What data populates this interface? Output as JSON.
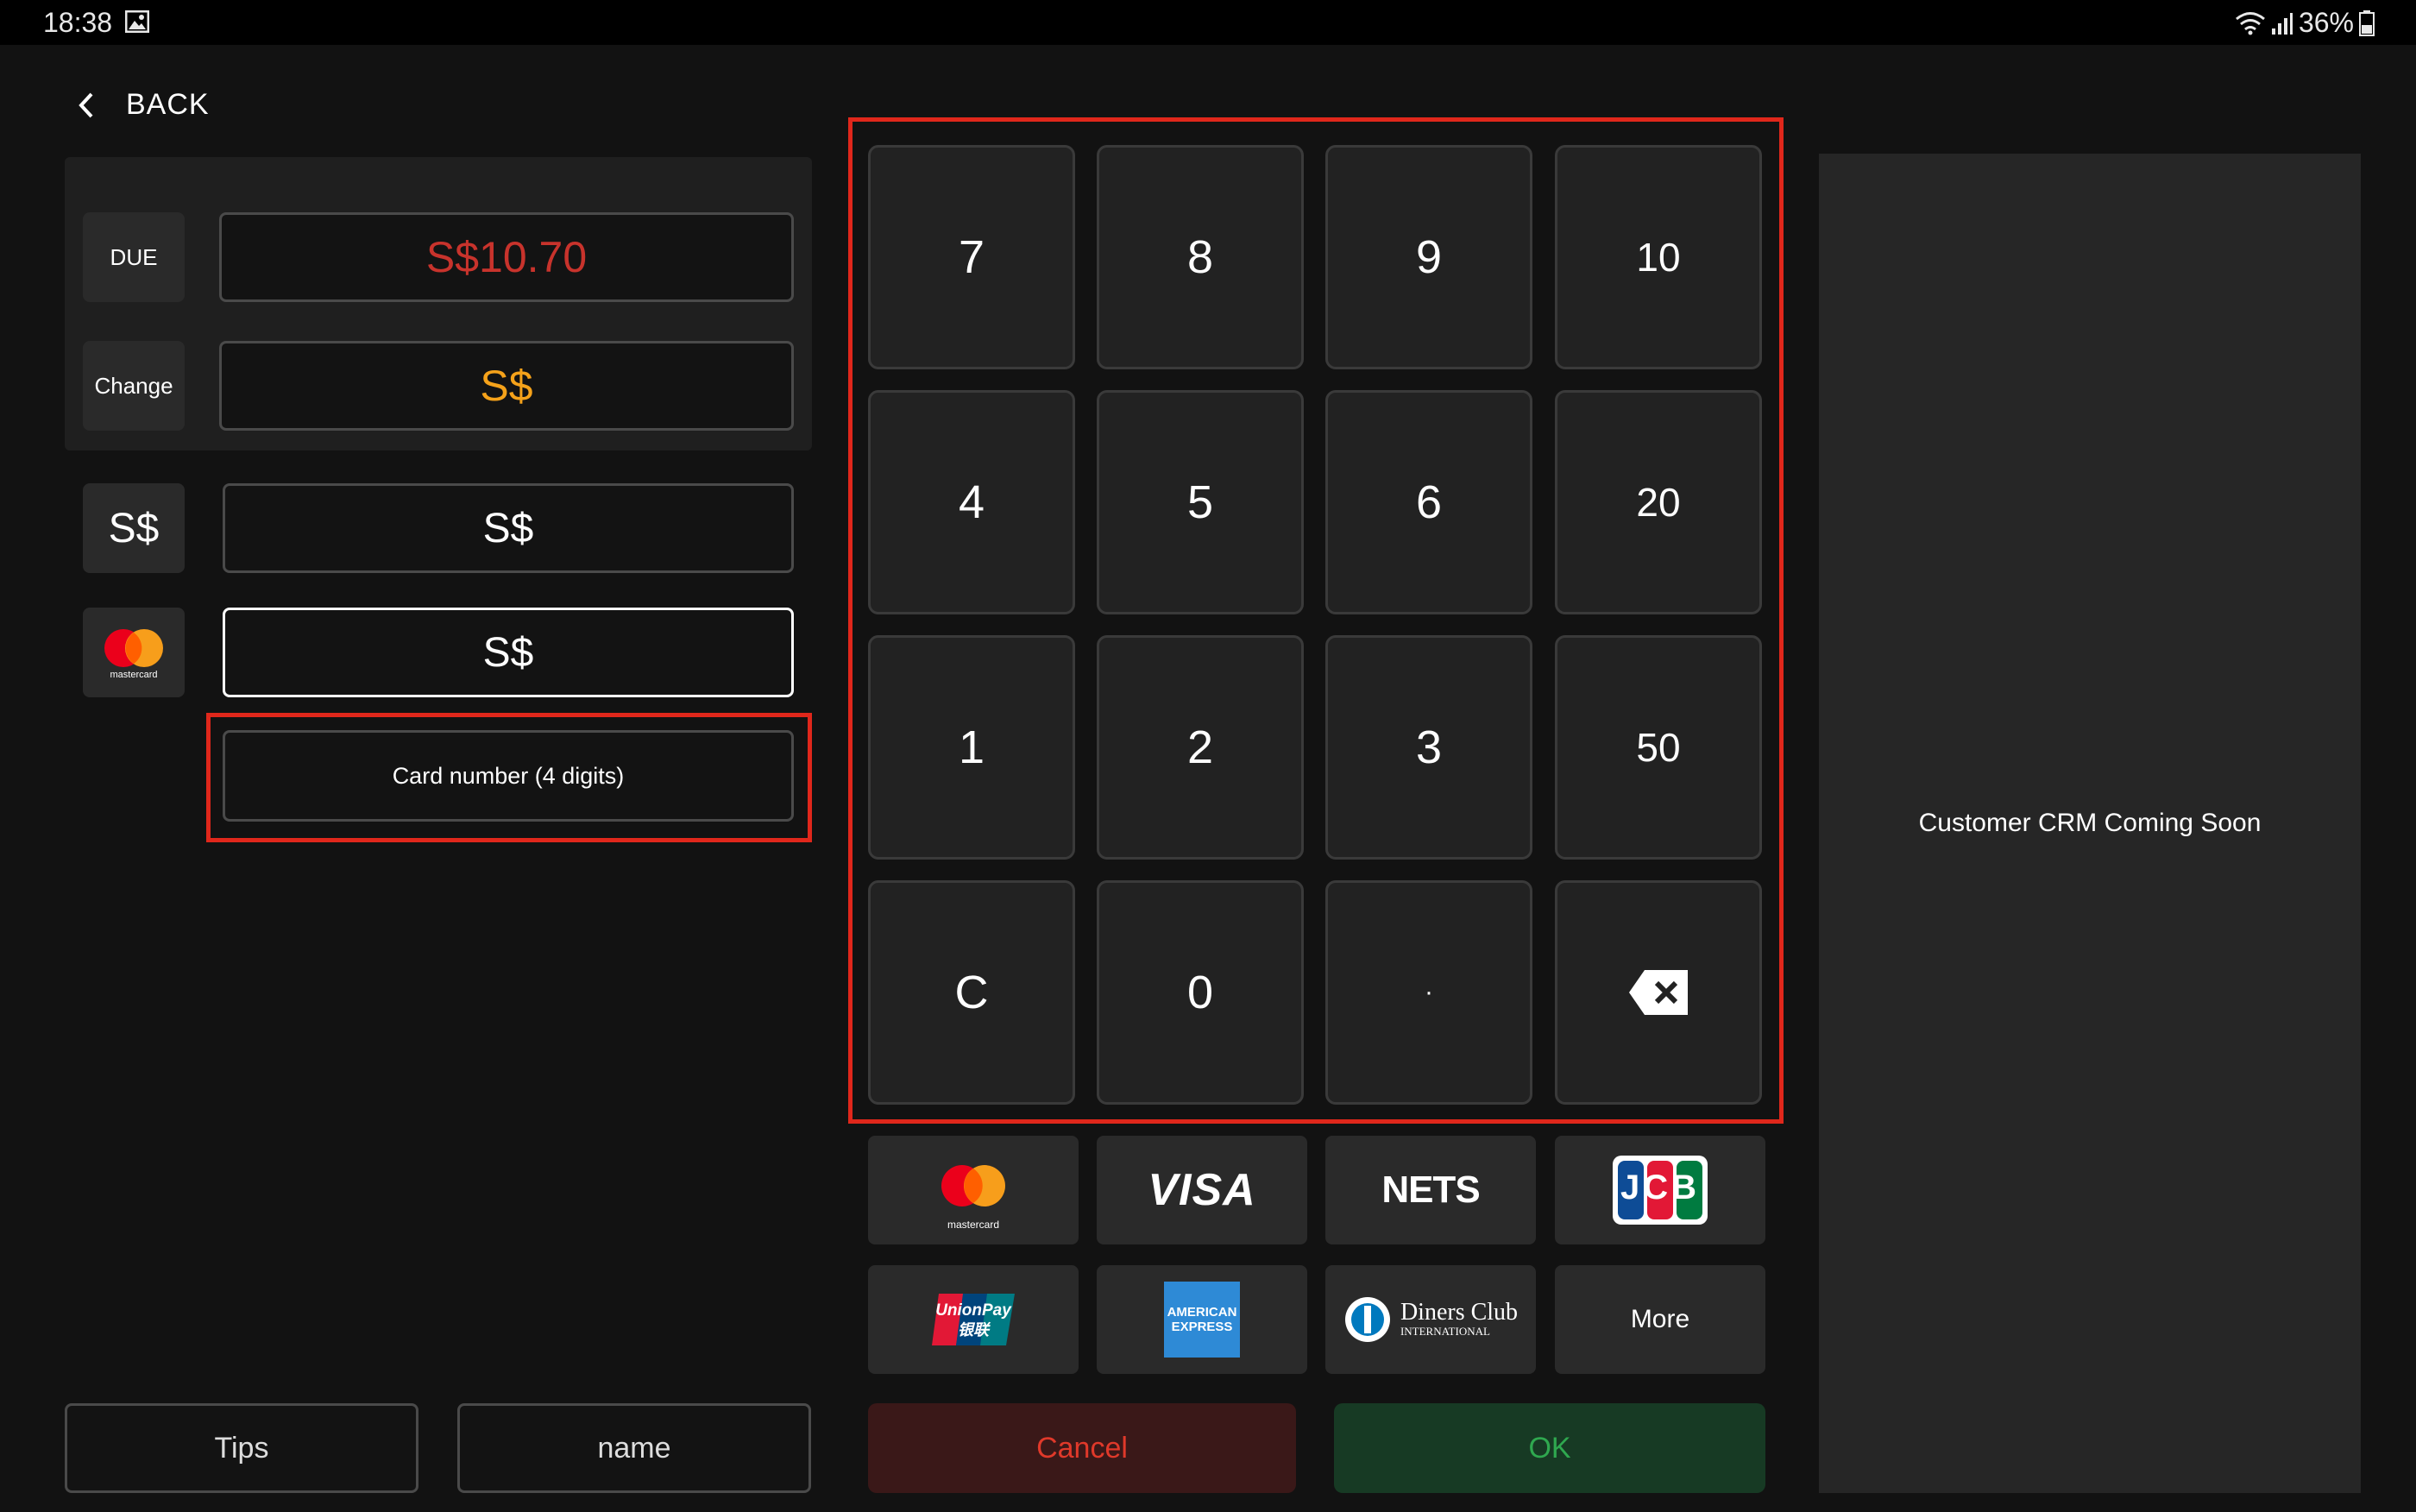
{
  "status_bar": {
    "time": "18:38",
    "battery": "36%"
  },
  "back_label": "BACK",
  "summary": {
    "due_label": "DUE",
    "due_value": "S$10.70",
    "change_label": "Change",
    "change_value": "S$"
  },
  "payments": {
    "cash_label": "S$",
    "cash_value": "S$",
    "card_value": "S$",
    "card_number_placeholder": "Card number (4 digits)"
  },
  "keypad": [
    "7",
    "8",
    "9",
    "10",
    "4",
    "5",
    "6",
    "20",
    "1",
    "2",
    "3",
    "50",
    "C",
    "0",
    "·"
  ],
  "brands": {
    "visa": "VISA",
    "nets": "NETS",
    "more": "More",
    "diners_line1": "Diners Club",
    "diners_line2": "INTERNATIONAL",
    "amex_line1": "AMERICAN",
    "amex_line2": "EXPRESS",
    "unionpay_line1": "UnionPay",
    "unionpay_line2": "银联",
    "mastercard": "mastercard",
    "jcb": "JCB"
  },
  "actions": {
    "cancel": "Cancel",
    "ok": "OK",
    "tips": "Tips",
    "name": "name"
  },
  "crm_text": "Customer CRM Coming Soon",
  "colors": {
    "due": "#c8332c",
    "change": "#f5a21a",
    "highlight": "#e0271b",
    "cancel_bg": "#3a1818",
    "cancel_text": "#e0392a",
    "ok_bg": "#173a24",
    "ok_text": "#2fa84f"
  }
}
